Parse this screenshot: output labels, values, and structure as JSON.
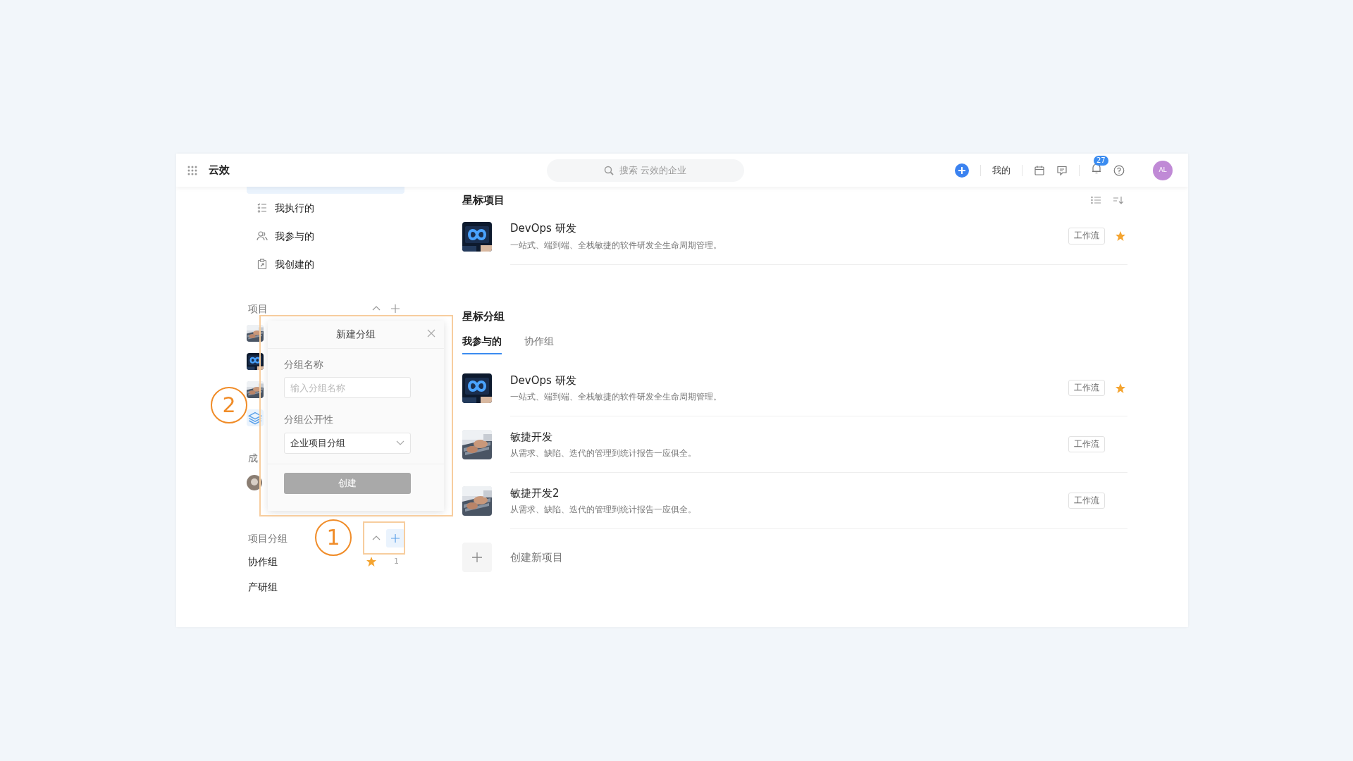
{
  "header": {
    "app_name": "云效",
    "search_placeholder": "搜索 云效的企业",
    "mine": "我的",
    "notification_count": "27",
    "avatar": "AL"
  },
  "sidebar": {
    "nav": [
      {
        "label": "我执行的"
      },
      {
        "label": "我参与的"
      },
      {
        "label": "我创建的"
      }
    ],
    "projects_title": "项目",
    "projects": [
      {
        "kind": "keyboard"
      },
      {
        "kind": "devops"
      },
      {
        "kind": "keyboard"
      },
      {
        "kind": "layers"
      }
    ],
    "members_title": "成",
    "groups_title": "项目分组",
    "groups": [
      {
        "label": "协作组",
        "starred": true,
        "count": "1"
      },
      {
        "label": "产研组",
        "starred": false
      }
    ]
  },
  "dialog": {
    "title": "新建分组",
    "name_label": "分组名称",
    "name_placeholder": "输入分组名称",
    "visibility_label": "分组公开性",
    "visibility_value": "企业项目分组",
    "submit": "创建",
    "submit_disabled": true
  },
  "callouts": [
    {
      "number": "1"
    },
    {
      "number": "2"
    }
  ],
  "main": {
    "starred_projects": {
      "title": "星标项目",
      "items": [
        {
          "kind": "devops",
          "name": "DevOps 研发",
          "description": "一站式、端到端、全栈敏捷的软件研发全生命周期管理。",
          "tag": "工作流",
          "starred": true
        }
      ]
    },
    "starred_groups": {
      "title": "星标分组",
      "tabs": [
        {
          "label": "我参与的",
          "selected": true
        },
        {
          "label": "协作组",
          "selected": false
        }
      ],
      "items": [
        {
          "kind": "devops",
          "name": "DevOps 研发",
          "description": "一站式、端到端、全栈敏捷的软件研发全生命周期管理。",
          "tag": "工作流",
          "starred": true
        },
        {
          "kind": "keyboard",
          "name": "敏捷开发",
          "description": "从需求、缺陷、迭代的管理到统计报告一应俱全。",
          "tag": "工作流",
          "starred": false
        },
        {
          "kind": "keyboard",
          "name": "敏捷开发2",
          "description": "从需求、缺陷、迭代的管理到统计报告一应俱全。",
          "tag": "工作流",
          "starred": false
        }
      ]
    },
    "create_label": "创建新项目"
  }
}
